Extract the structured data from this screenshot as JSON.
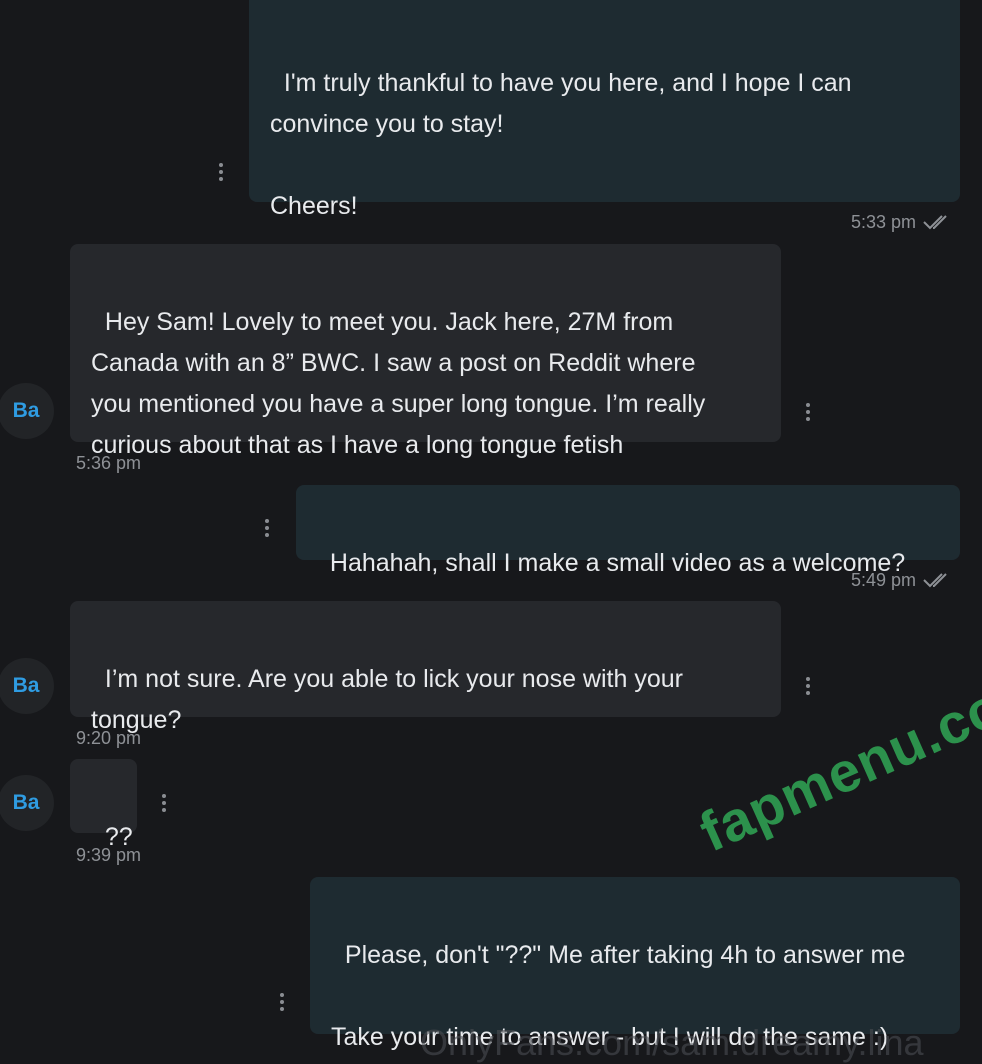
{
  "messages": [
    {
      "id": "m1",
      "direction": "out",
      "text": "I'm truly thankful to have you here, and I hope I can\nconvince you to stay!\n\nCheers!",
      "time": "5:33 pm"
    },
    {
      "id": "m2",
      "direction": "in",
      "avatar": "Ba",
      "text": "Hey Sam! Lovely to meet you. Jack here, 27M from\nCanada with an 8” BWC. I saw a post on Reddit where\nyou mentioned you have a super long tongue. I’m really\ncurious about that as I have a long tongue fetish",
      "time": "5:36 pm"
    },
    {
      "id": "m3",
      "direction": "out",
      "text": "Hahahah, shall I make a small video as a welcome?",
      "time": "5:49 pm"
    },
    {
      "id": "m4",
      "direction": "in",
      "avatar": "Ba",
      "text": "I’m not sure. Are you able to lick your nose with your\ntongue?",
      "time": "9:20 pm"
    },
    {
      "id": "m5",
      "direction": "in",
      "avatar": "Ba",
      "text": "??",
      "time": "9:39 pm"
    },
    {
      "id": "m6",
      "direction": "out",
      "text": "Please, don't \"??\" Me after taking 4h to answer me\n\nTake your time to answer - but I will do the same :)"
    }
  ],
  "icons": {
    "message_menu": "more-vertical-icon",
    "read_receipt": "double-check-icon"
  },
  "colors": {
    "background": "#17181b",
    "outgoing_bubble": "#1e2b31",
    "incoming_bubble": "#26282c",
    "avatar_text": "#2f9ce2",
    "watermark": "#2f9f52"
  },
  "watermarks": {
    "site": "fapmenu.com",
    "footer": "OnlyFans.com/sam.dreamy.lina"
  }
}
